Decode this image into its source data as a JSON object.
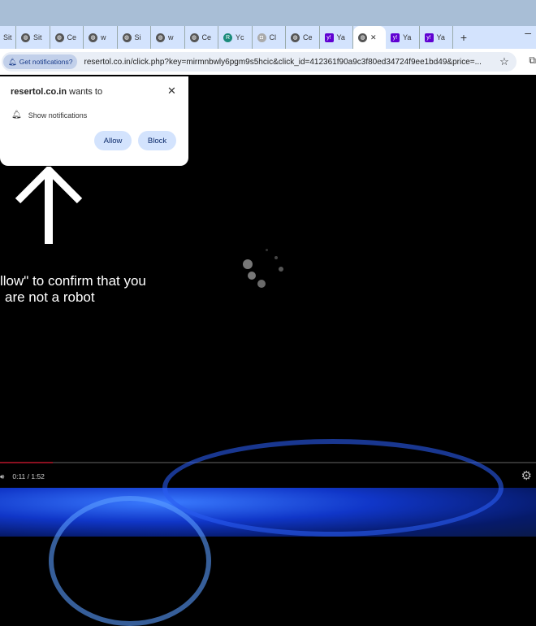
{
  "browser": {
    "tabs": [
      {
        "label": "Sit",
        "icon": "globe-icon"
      },
      {
        "label": "Sit",
        "icon": "globe-icon"
      },
      {
        "label": "Ce",
        "icon": "globe-icon"
      },
      {
        "label": "w",
        "icon": "globe-icon"
      },
      {
        "label": "Si",
        "icon": "globe-icon"
      },
      {
        "label": "w",
        "icon": "globe-icon"
      },
      {
        "label": "Ce",
        "icon": "globe-icon"
      },
      {
        "label": "Yc",
        "icon": "teal-badge-icon"
      },
      {
        "label": "Cl",
        "icon": "robot-icon"
      },
      {
        "label": "Ce",
        "icon": "globe-icon"
      },
      {
        "label": "Ya",
        "icon": "yahoo-icon"
      },
      {
        "label": "",
        "icon": "globe-icon",
        "active": true
      },
      {
        "label": "Ya",
        "icon": "yahoo-icon"
      },
      {
        "label": "Ya",
        "icon": "yahoo-icon"
      }
    ],
    "new_tab": "+",
    "minimize": "–",
    "notification_chip": "Get notifications?",
    "url": "resertol.co.in/click.php?key=mirmnbwly6pgm9s5hcic&click_id=412361f90a9c3f80ed34724f9ee1bd49&price=..."
  },
  "permission_popup": {
    "site": "resertol.co.in",
    "wants_to": "wants to",
    "permission": "Show notifications",
    "allow": "Allow",
    "block": "Block"
  },
  "page": {
    "message_line1": "llow\" to confirm that you",
    "message_line2": "are not a robot"
  },
  "video": {
    "time": "0:11 / 1:52",
    "progress": 0.098,
    "progress_color": "#8b1020"
  }
}
